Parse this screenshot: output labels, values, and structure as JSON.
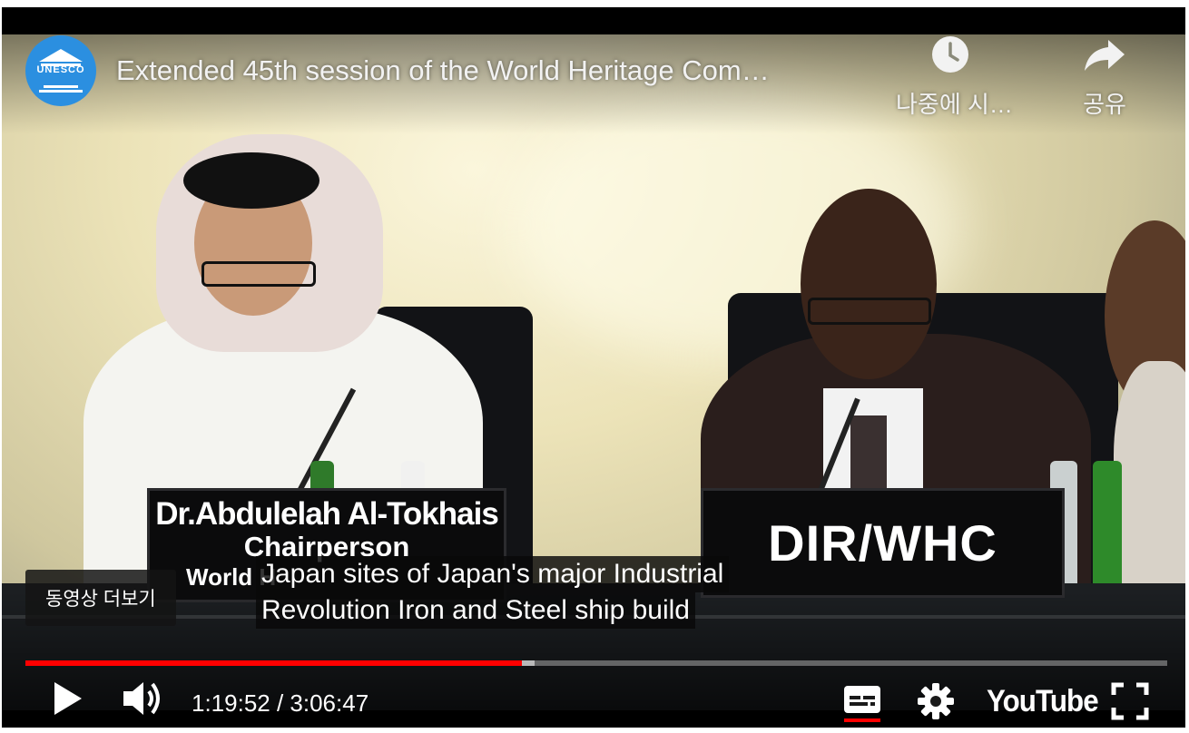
{
  "header": {
    "channel_logo_icon": "unesco-logo",
    "channel_logo_text": "UNESCO",
    "title": "Extended 45th session of the World Heritage Com…",
    "watch_later": {
      "icon": "clock-icon",
      "label": "나중에 시…"
    },
    "share": {
      "icon": "share-arrow-icon",
      "label": "공유"
    }
  },
  "scene": {
    "placard_left": {
      "line1": "Dr.Abdulelah Al-Tokhais",
      "line2": "Chairperson",
      "line3": "World H"
    },
    "placard_right": {
      "line1": "DIR/WHC"
    }
  },
  "overlay": {
    "more_videos": "동영상 더보기",
    "caption_line1": "Japan sites of Japan's major Industrial",
    "caption_line2": "Revolution Iron and Steel ship build"
  },
  "player": {
    "progress_played_fraction": 0.4346,
    "progress_loaded_fraction": 0.4456,
    "time_display": "1:19:52 / 3:06:47",
    "play_icon": "play-icon",
    "volume_icon": "volume-icon",
    "subtitles_icon": "subtitles-icon",
    "settings_icon": "gear-icon",
    "youtube_logo": "YouTube",
    "fullscreen_icon": "fullscreen-icon",
    "accent_color": "#ff0000"
  }
}
